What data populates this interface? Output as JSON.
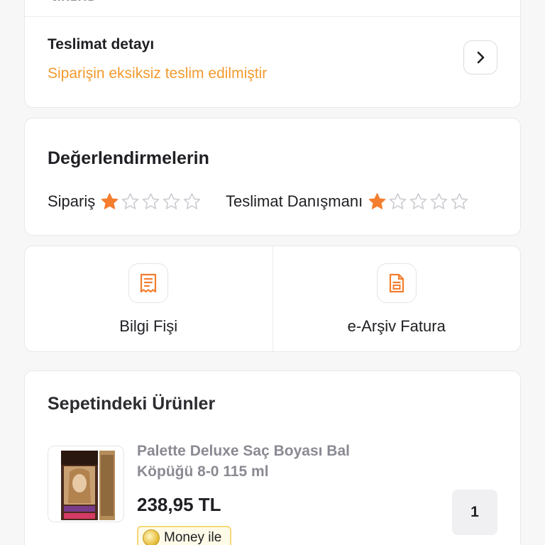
{
  "delivery": {
    "cut_text": "Sipariş",
    "title": "Teslimat detayı",
    "status": "Siparişin eksiksiz teslim edilmiştir"
  },
  "ratings": {
    "title": "Değerlendirmelerin",
    "order_label": "Sipariş",
    "order_stars": 1,
    "courier_label": "Teslimat Danışmanı",
    "courier_stars": 1,
    "max_stars": 5
  },
  "documents": {
    "info_receipt": "Bilgi Fişi",
    "e_invoice": "e-Arşiv Fatura"
  },
  "products": {
    "title": "Sepetindeki Ürünler",
    "items": [
      {
        "name": "Palette Deluxe Saç Boyası Bal Köpüğü 8-0 115 ml",
        "price": "238,95 TL",
        "quantity": "1",
        "badge": "Money ile"
      }
    ]
  },
  "colors": {
    "accent": "#f39a2e",
    "star_filled": "#f47e2e",
    "star_empty": "#c9c9cf"
  }
}
